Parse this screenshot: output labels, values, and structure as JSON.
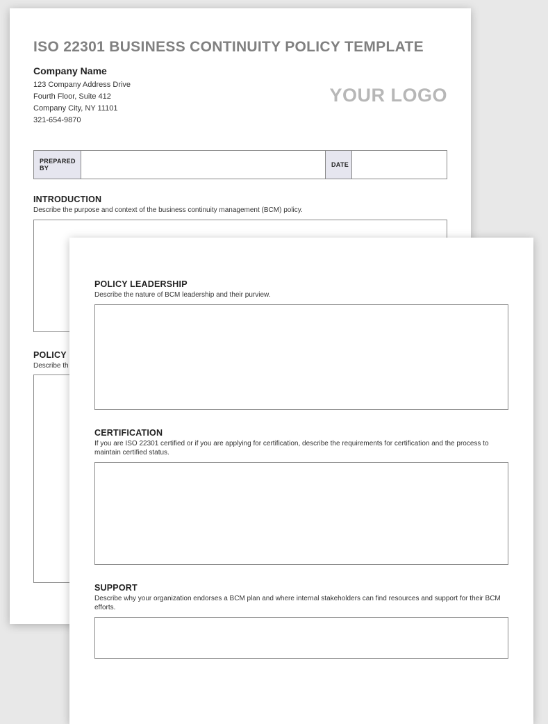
{
  "page1": {
    "title": "ISO 22301 BUSINESS CONTINUITY POLICY TEMPLATE",
    "company": {
      "name": "Company Name",
      "line1": "123 Company Address Drive",
      "line2": "Fourth Floor, Suite 412",
      "line3": "Company City, NY  11101",
      "line4": "321-654-9870"
    },
    "logo_text": "YOUR LOGO",
    "meta": {
      "prepared_by_label": "PREPARED BY",
      "date_label": "DATE"
    },
    "sections": {
      "intro": {
        "title": "INTRODUCTION",
        "desc": "Describe the purpose and context of the business continuity management (BCM) policy."
      },
      "policy": {
        "title": "POLICY",
        "desc": "Describe th"
      }
    }
  },
  "page2": {
    "sections": {
      "leadership": {
        "title": "POLICY LEADERSHIP",
        "desc": "Describe the nature of BCM leadership and their purview."
      },
      "certification": {
        "title": "CERTIFICATION",
        "desc": "If you are ISO 22301 certified or if you are applying for certification, describe the requirements for certification and the process to maintain certified status."
      },
      "support": {
        "title": "SUPPORT",
        "desc": "Describe why your organization endorses a BCM plan and where internal stakeholders can find resources and support for their BCM efforts."
      }
    }
  }
}
